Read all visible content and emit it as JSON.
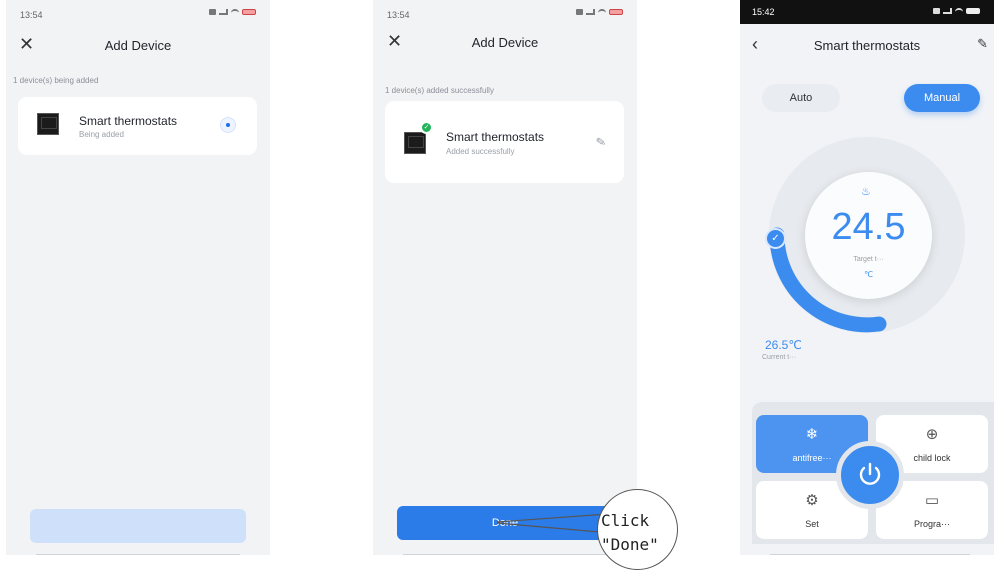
{
  "screen1": {
    "status_time": "13:54",
    "title": "Add Device",
    "caption": "1 device(s) being added",
    "device": {
      "name": "Smart thermostats",
      "status": "Being added"
    },
    "button_label": "",
    "colors": {
      "button": "#cfe0fb",
      "spinner": "#1f6fe6"
    }
  },
  "screen2": {
    "status_time": "13:54",
    "title": "Add Device",
    "caption": "1 device(s) added successfully",
    "device": {
      "name": "Smart thermostats",
      "status": "Added successfully"
    },
    "button_label": "Done",
    "callout": "Click\n\"Done\"",
    "colors": {
      "button": "#2b7ce9",
      "success": "#21b35a"
    }
  },
  "screen3": {
    "status_time": "15:42",
    "title": "Smart thermostats",
    "modes": {
      "auto": "Auto",
      "manual": "Manual",
      "selected": "Manual"
    },
    "target_temp": "24.5",
    "target_label": "Target t···",
    "unit": "℃",
    "current_temp": "26.5℃",
    "current_label": "Current t···",
    "controls": {
      "antifreeze": "antifree···",
      "child_lock": "child lock",
      "set": "Set",
      "program": "Progra···"
    },
    "icons": [
      "back-arrow-icon",
      "edit-icon",
      "flame-icon",
      "check-icon",
      "snowflake-icon",
      "lock-icon",
      "gear-icon",
      "monitor-icon",
      "power-icon"
    ],
    "colors": {
      "accent": "#3c8cf0",
      "panel": "#e3e7ec"
    }
  }
}
